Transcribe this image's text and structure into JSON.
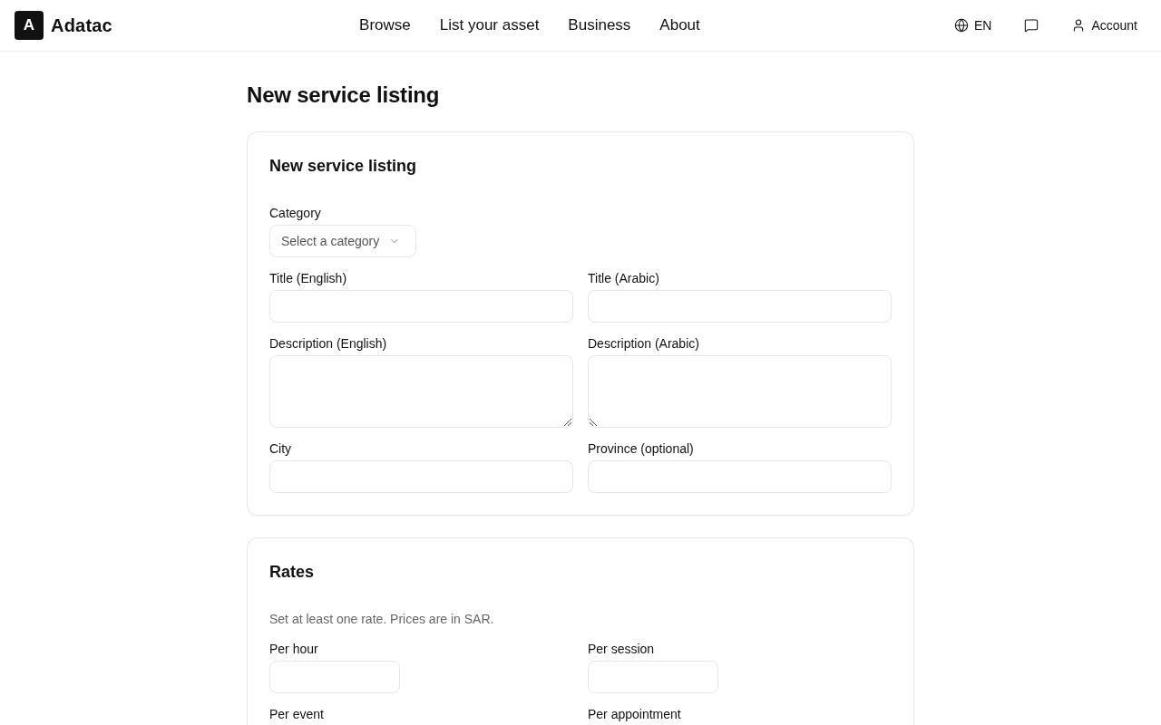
{
  "header": {
    "logo_mark": "A",
    "brand": "Adatac",
    "nav": [
      "Browse",
      "List your asset",
      "Business",
      "About"
    ],
    "language": "EN",
    "account": "Account"
  },
  "page_title": "New service listing",
  "sections": [
    {
      "title": "New service listing",
      "fields": [
        {
          "kind": "select",
          "label": "Category",
          "placeholder": "Select a category"
        },
        {
          "kind": "text",
          "label": "Title (English)"
        },
        {
          "kind": "text",
          "label": "Title (Arabic)"
        },
        {
          "kind": "textarea",
          "label": "Description (English)",
          "rtl": false
        },
        {
          "kind": "textarea",
          "label": "Description (Arabic)",
          "rtl": true
        },
        {
          "kind": "text",
          "label": "City"
        },
        {
          "kind": "text",
          "label": "Province (optional)"
        }
      ]
    },
    {
      "title": "Rates",
      "note": "Set at least one rate. Prices are in SAR.",
      "fields": [
        {
          "kind": "rate",
          "label": "Per hour"
        },
        {
          "kind": "rate",
          "label": "Per session"
        },
        {
          "kind": "rate",
          "label": "Per event"
        },
        {
          "kind": "rate",
          "label": "Per appointment"
        }
      ]
    }
  ]
}
